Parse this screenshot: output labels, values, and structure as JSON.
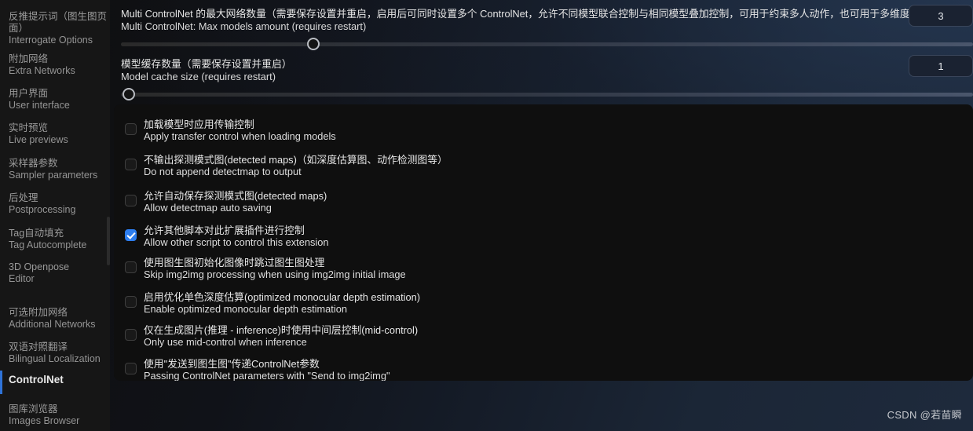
{
  "sidebar": {
    "items": [
      {
        "cn": "反推提示词（图生图页面）",
        "en": "Interrogate Options",
        "active": false
      },
      {
        "cn": "附加网络",
        "en": "Extra Networks",
        "active": false
      },
      {
        "cn": "用户界面",
        "en": "User interface",
        "active": false
      },
      {
        "cn": "实时预览",
        "en": "Live previews",
        "active": false
      },
      {
        "cn": "采样器参数",
        "en": "Sampler parameters",
        "active": false
      },
      {
        "cn": "后处理",
        "en": "Postprocessing",
        "active": false
      },
      {
        "cn": "Tag自动填充",
        "en": "Tag Autocomplete",
        "active": false
      },
      {
        "cn": "3D Openpose",
        "en": "Editor",
        "active": false
      },
      {
        "cn": "可选附加网络",
        "en": "Additional Networks",
        "active": false
      },
      {
        "cn": "双语对照翻译",
        "en": "Bilingual Localization",
        "active": false
      },
      {
        "cn": "ControlNet",
        "en": "",
        "active": true
      },
      {
        "cn": "图库浏览器",
        "en": "Images Browser",
        "active": false
      }
    ]
  },
  "settings": {
    "sliders": [
      {
        "label_cn": "Multi ControlNet 的最大网络数量（需要保存设置并重启，启用后可同时设置多个 ControlNet，允许不同模型联合控制与相同模型叠加控制，可用于约束多人动作，也可用于多维度约束）",
        "label_en": "Multi ControlNet: Max models amount (requires restart)",
        "value": "3",
        "thumb_percent": 22.6
      },
      {
        "label_cn": "模型缓存数量（需要保存设置并重启）",
        "label_en": "Model cache size (requires restart)",
        "value": "1",
        "thumb_percent": 0.9
      }
    ],
    "checkboxes": [
      {
        "label_cn": "加载模型时应用传输控制",
        "label_en": "Apply transfer control when loading models",
        "checked": false
      },
      {
        "label_cn": "不输出探测模式图(detected maps)（如深度估算图、动作检测图等）",
        "label_en": "Do not append detectmap to output",
        "checked": false
      },
      {
        "label_cn": "允许自动保存探测模式图(detected maps)",
        "label_en": "Allow detectmap auto saving",
        "checked": false
      },
      {
        "label_cn": "允许其他脚本对此扩展插件进行控制",
        "label_en": "Allow other script to control this extension",
        "checked": true
      },
      {
        "label_cn": "使用图生图初始化图像时跳过图生图处理",
        "label_en": "Skip img2img processing when using img2img initial image",
        "checked": false
      },
      {
        "label_cn": "启用优化单色深度估算(optimized monocular depth estimation)",
        "label_en": "Enable optimized monocular depth estimation",
        "checked": false
      },
      {
        "label_cn": "仅在生成图片(推理 - inference)时使用中间层控制(mid-control)",
        "label_en": "Only use mid-control when inference",
        "checked": false
      },
      {
        "label_cn": "使用\"发送到图生图\"传递ControlNet参数",
        "label_en": "Passing ControlNet parameters with \"Send to img2img\"",
        "checked": false
      }
    ]
  },
  "watermark": {
    "text": "CSDN @若苗瞬"
  },
  "colors": {
    "accent_blue": "#2d7ef0",
    "active_bar": "#2f73d8",
    "panel_bg": "#0f0f0f",
    "sidebar_bg": "#161616"
  }
}
